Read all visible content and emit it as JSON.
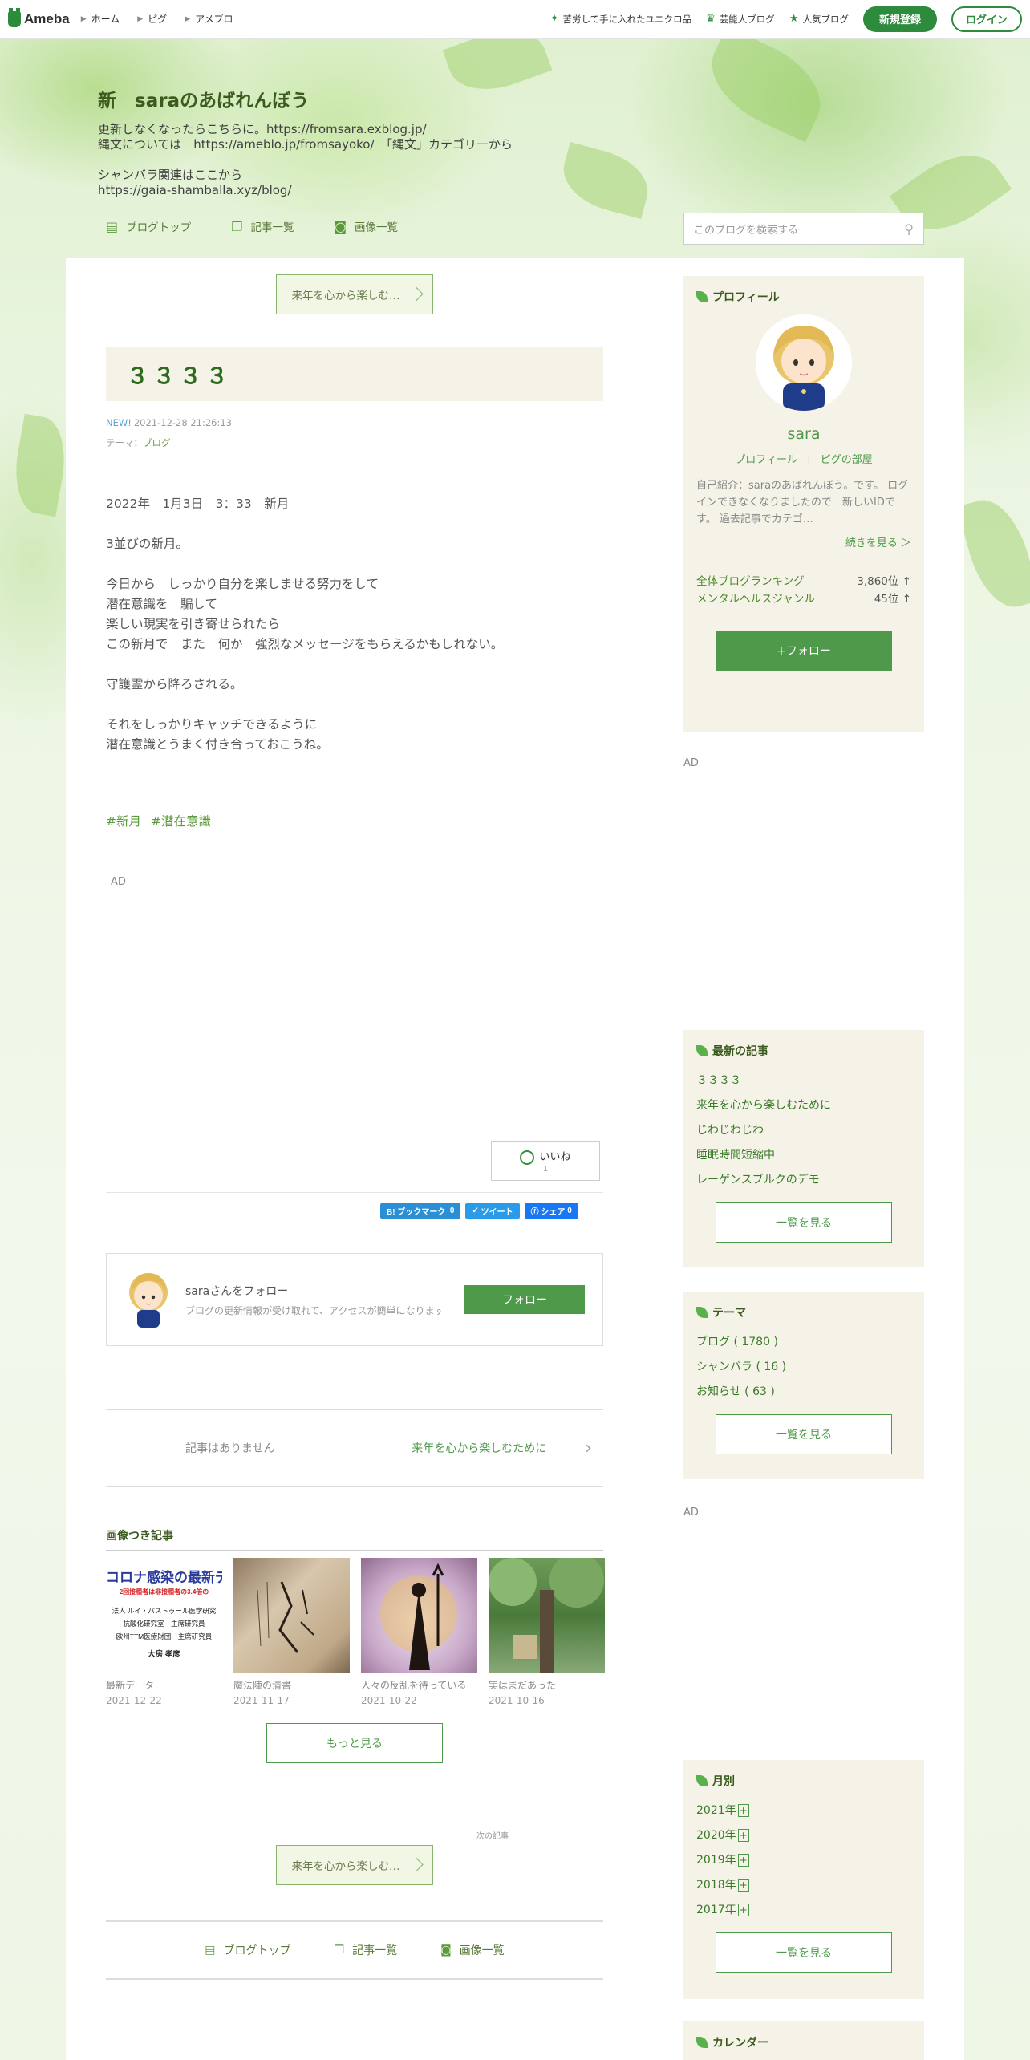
{
  "topbar": {
    "logo": "Ameba",
    "nav": [
      "ホーム",
      "ピグ",
      "アメブロ"
    ],
    "links": [
      {
        "icon": "sparkle-icon",
        "label": "苦労して手に入れたユニクロ品"
      },
      {
        "icon": "crown-icon",
        "label": "芸能人ブログ"
      },
      {
        "icon": "star-icon",
        "label": "人気ブログ"
      }
    ],
    "register": "新規登録",
    "login": "ログイン"
  },
  "header": {
    "title": "新　saraのあばれんぼう",
    "description": "更新しなくなったらこちらに。https://fromsara.exblog.jp/\n縄文については　https://ameblo.jp/fromsayoko/　「縄文」カテゴリーから\n\nシャンバラ関連はここから\nhttps://gaia-shamballa.xyz/blog/",
    "nav": [
      "ブログトップ",
      "記事一覧",
      "画像一覧"
    ],
    "search_placeholder": "このブログを検索する"
  },
  "entry": {
    "next_top": "来年を心から楽しむ…",
    "title": "３３３３",
    "new_badge": "NEW!",
    "datetime": "2021-12-28 21:26:13",
    "theme_label": "テーマ：",
    "theme": "ブログ",
    "body": "2022年　1月3日　3：33　新月\n\n3並びの新月。\n\n今日から　しっかり自分を楽しませる努力をして\n潜在意識を　騙して\n楽しい現実を引き寄せられたら\nこの新月で　また　何か　強烈なメッセージをもらえるかもしれない。\n\n守護霊から降ろされる。\n\nそれをしっかりキャッチできるように\n潜在意識とうまく付き合っておこうね。",
    "tags": [
      "#新月",
      "#潜在意識"
    ],
    "ad_label": "AD",
    "iine_label": "いいね",
    "iine_count": "1",
    "share": {
      "hatena": "B! ブックマーク",
      "hatena_count": "0",
      "tweet": "ツイート",
      "fb": "シェア",
      "fb_count": "0"
    },
    "follow_name": "saraさんをフォロー",
    "follow_sub": "ブログの更新情報が受け取れて、アクセスが簡単になります",
    "follow_btn": "フォロー",
    "prev": "記事はありません",
    "next": "来年を心から楽しむために",
    "images_heading": "画像つき記事",
    "images": [
      {
        "caption": "最新データ",
        "date": "2021-12-22"
      },
      {
        "caption": "魔法陣の清書",
        "date": "2021-11-17"
      },
      {
        "caption": "人々の反乱を待っている",
        "date": "2021-10-22"
      },
      {
        "caption": "実はまだあった",
        "date": "2021-10-16"
      }
    ],
    "thumb1_lines": [
      "コロナ感染の最新デ",
      "2回接種者は非接種者の3.4倍の",
      "法人 ルイ・パストゥール医学研究",
      "抗酸化研究室　主席研究員",
      "欧州TTM医療財団　主席研究員",
      "大房 孝彦"
    ],
    "more": "もっと見る",
    "next_label": "次の記事",
    "next_bottom": "来年を心から楽しむ…",
    "bottom_nav": [
      "ブログトップ",
      "記事一覧",
      "画像一覧"
    ]
  },
  "sidebar": {
    "profile": {
      "heading": "プロフィール",
      "name": "sara",
      "links": [
        "プロフィール",
        "ピグの部屋"
      ],
      "intro": "自己紹介：saraのあばれんぼう。です。 ログインできなくなりましたので　新しいIDです。 過去記事でカテゴ…",
      "more": "続きを見る ＞",
      "ranks": [
        {
          "label": "全体ブログランキング",
          "value": "3,860位 ↑"
        },
        {
          "label": "メンタルヘルスジャンル",
          "value": "45位 ↑"
        }
      ],
      "follow": "+フォロー"
    },
    "ad1": "AD",
    "recent": {
      "heading": "最新の記事",
      "items": [
        "３３３３",
        "来年を心から楽しむために",
        "じわじわじわ",
        "睡眠時間短縮中",
        "レーゲンスブルクのデモ"
      ],
      "more": "一覧を見る"
    },
    "theme": {
      "heading": "テーマ",
      "items": [
        "ブログ ( 1780 )",
        "シャンバラ ( 16 )",
        "お知らせ ( 63 )"
      ],
      "more": "一覧を見る"
    },
    "ad2": "AD",
    "monthly": {
      "heading": "月別",
      "items": [
        "2021年",
        "2020年",
        "2019年",
        "2018年",
        "2017年"
      ],
      "more": "一覧を見る"
    },
    "calendar": {
      "heading": "カレンダー"
    }
  },
  "colors": {
    "accent": "#2e8b3e",
    "title_bg": "#f5f3e7",
    "link": "#4e9a4a"
  }
}
